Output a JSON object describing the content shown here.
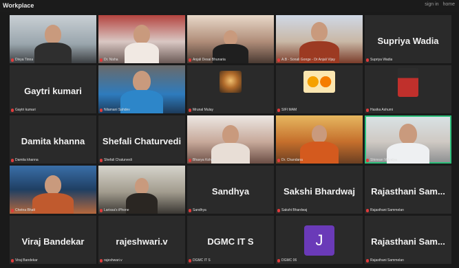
{
  "window": {
    "title": "Workplace",
    "controls": [
      "sign in",
      "home"
    ]
  },
  "colors": {
    "active_speaker": "#2bbf7a",
    "avatar_j": "#6a3ab8",
    "mic_muted": "#e03b3b"
  },
  "tiles": [
    {
      "label": "Divya Tinna",
      "big": ""
    },
    {
      "label": "Dr. Nisha",
      "big": ""
    },
    {
      "label": "Anjali Desai Bhunaria",
      "big": ""
    },
    {
      "label": "A.B - Sonali Gonge - Dr Anjali Vijay",
      "big": ""
    },
    {
      "label": "Supriya Wadia",
      "big": "Supriya Wadia"
    },
    {
      "label": "Gaytri kumari",
      "big": "Gaytri kumari"
    },
    {
      "label": "Nilamani Sahdev",
      "big": ""
    },
    {
      "label": "Mrunal Mulay",
      "big": "",
      "icon": "shiva-image"
    },
    {
      "label": "SIFI MAM",
      "big": "",
      "icon": "sunflowers-image"
    },
    {
      "label": "Hasika Ashumi",
      "big": "",
      "icon": "boy-image"
    },
    {
      "label": "Damita khanna",
      "big": "Damita khanna"
    },
    {
      "label": "Shefali Chaturvedi",
      "big": "Shefali Chaturvedi"
    },
    {
      "label": "Bhavya Kohan",
      "big": ""
    },
    {
      "label": "Dr. Chandana",
      "big": ""
    },
    {
      "label": "Shimran Vidyalya",
      "big": "",
      "active": true
    },
    {
      "label": "Chetna Bhatt",
      "big": ""
    },
    {
      "label": "Larissa's iPhone",
      "big": ""
    },
    {
      "label": "Sandhya",
      "big": "Sandhya"
    },
    {
      "label": "Sakshi Bhardwaj",
      "big": "Sakshi Bhardwaj"
    },
    {
      "label": "Rajasthani Sammelan",
      "big": "Rajasthani Sam..."
    },
    {
      "label": "Viraj Bandekar",
      "big": "Viraj Bandekar"
    },
    {
      "label": "rajeshwari.v",
      "big": "rajeshwari.v"
    },
    {
      "label": "DGMC IT S",
      "big": "DGMC IT S"
    },
    {
      "label": "DGMC 06",
      "big": "",
      "avatar": "J"
    },
    {
      "label": "Rajasthani Sammelan",
      "big": "Rajasthani Sam..."
    }
  ]
}
